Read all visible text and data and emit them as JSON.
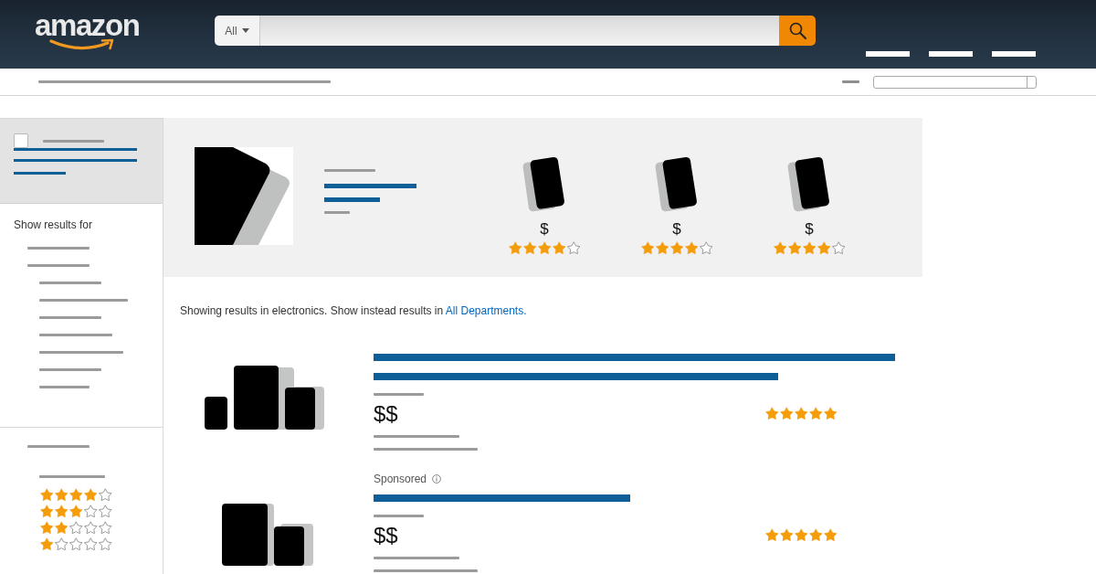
{
  "header": {
    "logo": "amazon",
    "search": {
      "category": "All"
    }
  },
  "sidebar": {
    "department_panel": {
      "checked": false
    },
    "heading": "Show results for",
    "rating_filters": [
      {
        "stars": 4
      },
      {
        "stars": 3
      },
      {
        "stars": 2
      },
      {
        "stars": 1
      }
    ]
  },
  "banner": {
    "products": [
      {
        "price": "$",
        "stars": 4
      },
      {
        "price": "$",
        "stars": 4
      },
      {
        "price": "$",
        "stars": 4
      }
    ]
  },
  "results_note": {
    "text": "Showing results in electronics. Show instead results in ",
    "link": "All Departments."
  },
  "results": [
    {
      "kind": "trio",
      "price": "$$",
      "stars": 5
    },
    {
      "kind": "pair",
      "label": "Sponsored",
      "price": "$$",
      "stars": 5
    }
  ]
}
